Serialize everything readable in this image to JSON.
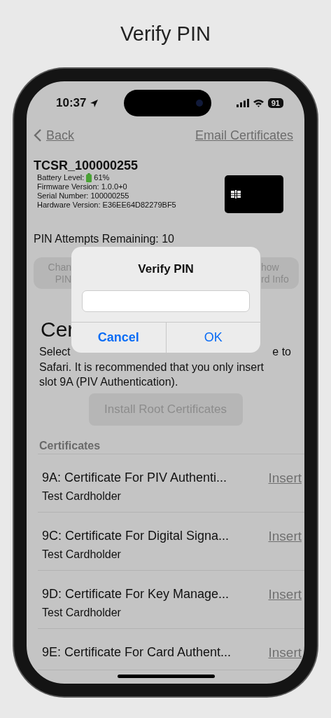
{
  "page_title": "Verify PIN",
  "status_bar": {
    "time": "10:37",
    "battery": "91"
  },
  "nav": {
    "back": "Back",
    "action": "Email Certificates"
  },
  "device": {
    "name": "TCSR_100000255",
    "battery_label": "Battery Level:",
    "battery_value": "61%",
    "info": [
      "Firmware Version: 1.0.0+0",
      "Serial Number: 100000255",
      "Hardware Version: E36EE64D82279BF5"
    ]
  },
  "pin_attempts": "PIN Attempts Remaining:  10",
  "buttons": [
    {
      "lines": [
        "Chan",
        "PIN"
      ]
    },
    {
      "lines": [
        "how",
        "rd Info"
      ]
    }
  ],
  "heading": "Cer",
  "description": {
    "line_start": "Select",
    "line_end": "e to",
    "rest": "Safari. It is recommended that you only insert slot 9A (PIV Authentication)."
  },
  "install_button": {
    "label": "Install Root Certificates",
    "disabled": true
  },
  "certificates": {
    "header": "Certificates",
    "rows": [
      {
        "title": "9A: Certificate For PIV Authenti...",
        "subtitle": "Test Cardholder",
        "action": "Insert"
      },
      {
        "title": "9C: Certificate For Digital Signa...",
        "subtitle": "Test Cardholder",
        "action": "Insert"
      },
      {
        "title": "9D: Certificate For Key Manage...",
        "subtitle": "Test Cardholder",
        "action": "Insert"
      },
      {
        "title": "9E: Certificate For Card Authent...",
        "action": "Insert"
      }
    ]
  },
  "dialog": {
    "title": "Verify PIN",
    "buttons": [
      {
        "label": "Cancel",
        "kind": "cancel"
      },
      {
        "label": "OK",
        "kind": "default"
      }
    ]
  }
}
